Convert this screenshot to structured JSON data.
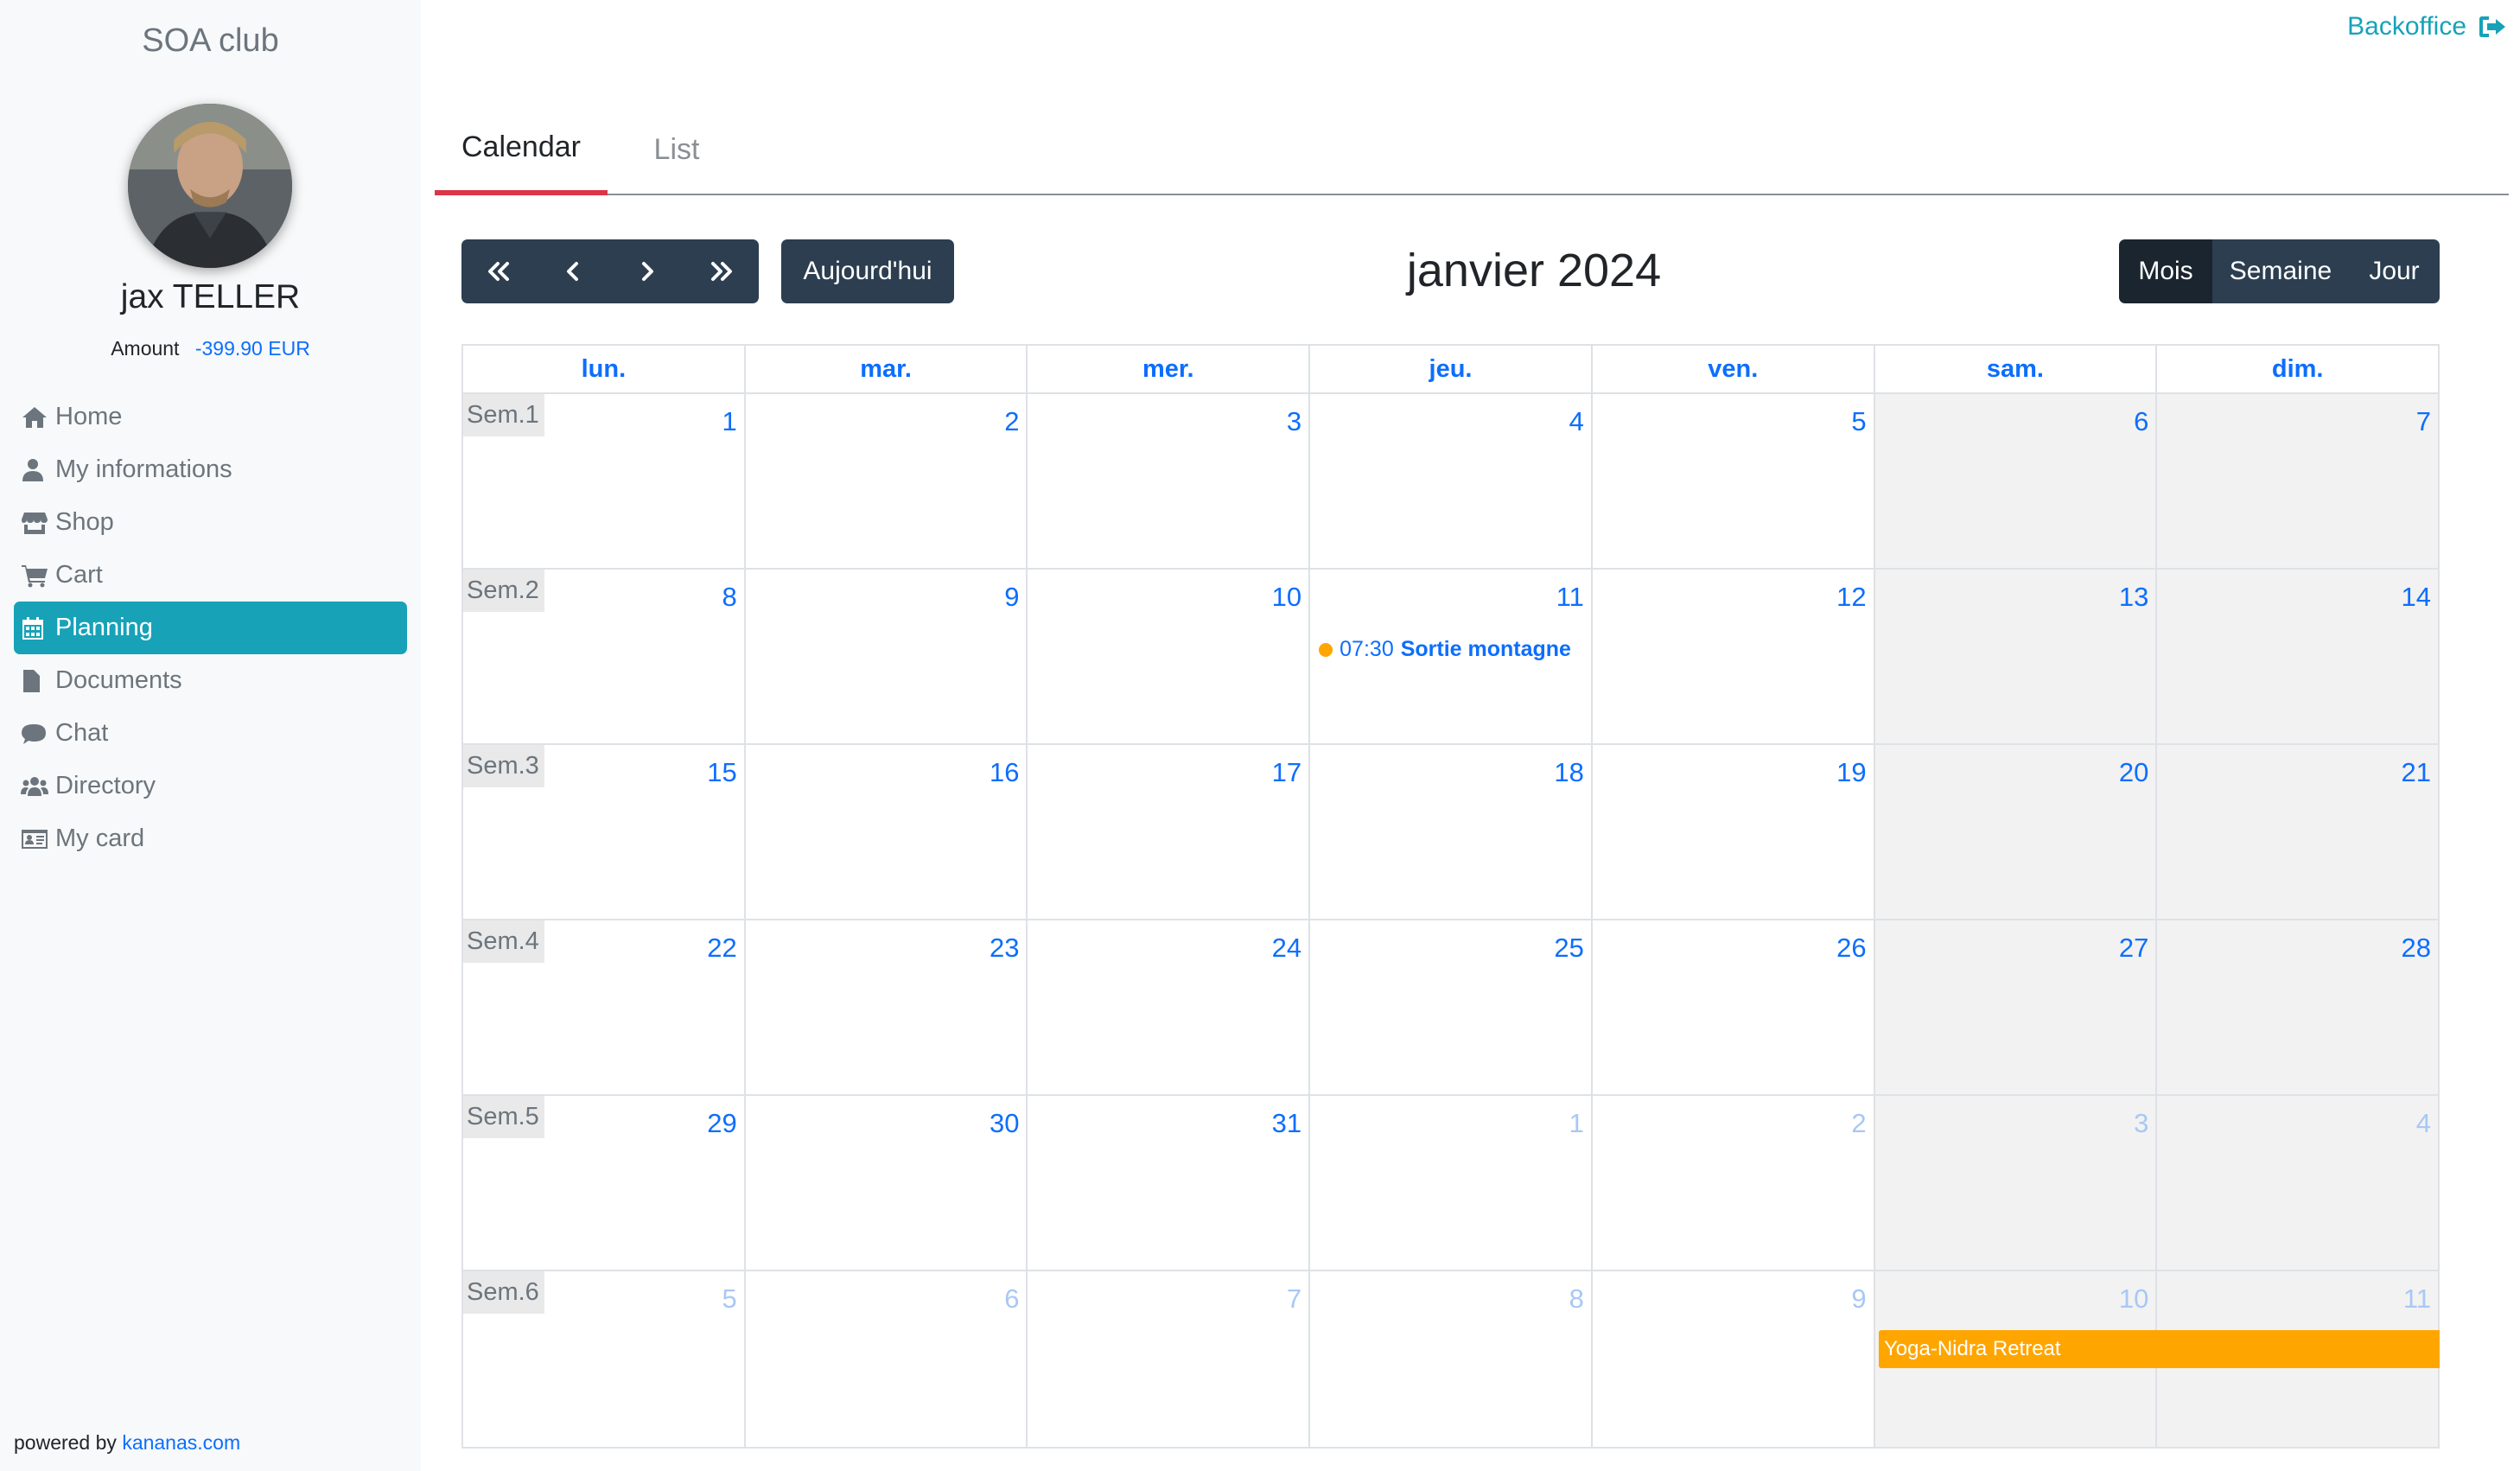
{
  "sidebar": {
    "club_name": "SOA club",
    "user_name": "jax TELLER",
    "amount_label": "Amount",
    "amount_value": "-399.90 EUR",
    "nav": [
      {
        "label": "Home",
        "icon": "home-icon"
      },
      {
        "label": "My informations",
        "icon": "user-icon"
      },
      {
        "label": "Shop",
        "icon": "store-icon"
      },
      {
        "label": "Cart",
        "icon": "cart-icon"
      },
      {
        "label": "Planning",
        "icon": "calendar-icon",
        "active": true
      },
      {
        "label": "Documents",
        "icon": "file-icon"
      },
      {
        "label": "Chat",
        "icon": "comment-icon"
      },
      {
        "label": "Directory",
        "icon": "users-icon"
      },
      {
        "label": "My card",
        "icon": "id-card-icon"
      }
    ],
    "powered_prefix": "powered by",
    "powered_link": "kananas.com"
  },
  "topbar": {
    "backoffice_label": "Backoffice",
    "backoffice_icon": "sign-out-icon"
  },
  "tabs": [
    {
      "label": "Calendar",
      "active": true
    },
    {
      "label": "List",
      "active": false
    }
  ],
  "toolbar": {
    "nav_buttons": [
      "prev-year-icon",
      "prev-icon",
      "next-icon",
      "next-year-icon"
    ],
    "today_label": "Aujourd'hui",
    "title": "janvier 2024",
    "views": [
      {
        "label": "Mois",
        "active": true
      },
      {
        "label": "Semaine",
        "active": false
      },
      {
        "label": "Jour",
        "active": false
      }
    ]
  },
  "calendar": {
    "day_headers": [
      "lun.",
      "mar.",
      "mer.",
      "jeu.",
      "ven.",
      "sam.",
      "dim."
    ],
    "weeks": [
      {
        "label": "Sem.1",
        "days": [
          {
            "n": "1"
          },
          {
            "n": "2"
          },
          {
            "n": "3"
          },
          {
            "n": "4"
          },
          {
            "n": "5"
          },
          {
            "n": "6"
          },
          {
            "n": "7"
          }
        ]
      },
      {
        "label": "Sem.2",
        "days": [
          {
            "n": "8"
          },
          {
            "n": "9"
          },
          {
            "n": "10"
          },
          {
            "n": "11",
            "event": {
              "time": "07:30",
              "title": "Sortie montagne"
            }
          },
          {
            "n": "12"
          },
          {
            "n": "13"
          },
          {
            "n": "14"
          }
        ]
      },
      {
        "label": "Sem.3",
        "days": [
          {
            "n": "15"
          },
          {
            "n": "16"
          },
          {
            "n": "17"
          },
          {
            "n": "18"
          },
          {
            "n": "19"
          },
          {
            "n": "20"
          },
          {
            "n": "21"
          }
        ]
      },
      {
        "label": "Sem.4",
        "days": [
          {
            "n": "22"
          },
          {
            "n": "23"
          },
          {
            "n": "24"
          },
          {
            "n": "25"
          },
          {
            "n": "26"
          },
          {
            "n": "27"
          },
          {
            "n": "28"
          }
        ]
      },
      {
        "label": "Sem.5",
        "days": [
          {
            "n": "29"
          },
          {
            "n": "30"
          },
          {
            "n": "31"
          },
          {
            "n": "1",
            "other": true
          },
          {
            "n": "2",
            "other": true
          },
          {
            "n": "3",
            "other": true
          },
          {
            "n": "4",
            "other": true
          }
        ]
      },
      {
        "label": "Sem.6",
        "days": [
          {
            "n": "5",
            "other": true
          },
          {
            "n": "6",
            "other": true
          },
          {
            "n": "7",
            "other": true
          },
          {
            "n": "8",
            "other": true
          },
          {
            "n": "9",
            "other": true
          },
          {
            "n": "10",
            "other": true
          },
          {
            "n": "11",
            "other": true
          }
        ],
        "bar_event": {
          "title": "Yoga-Nidra Retreat"
        }
      }
    ]
  },
  "colors": {
    "accent": "#17a2b8",
    "link": "#0d6efd",
    "tab_active": "#dc3545",
    "button": "#2c3e50",
    "event": "#ffa500"
  }
}
